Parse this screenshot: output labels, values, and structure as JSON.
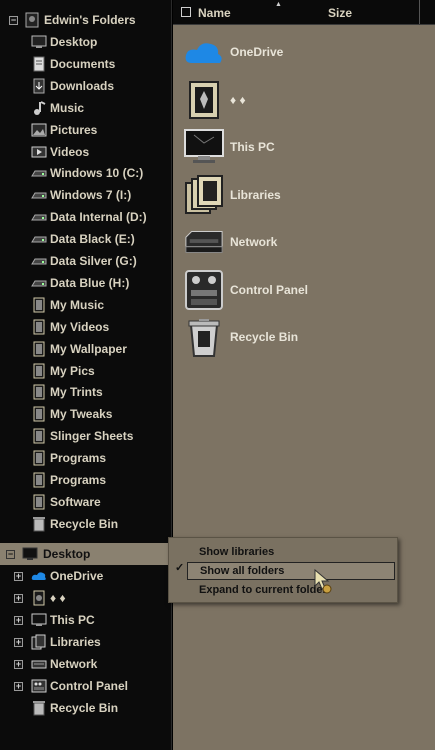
{
  "nav": {
    "root": {
      "label": "Edwin's Folders",
      "icon": "user-folder-icon"
    },
    "items": [
      {
        "label": "Desktop",
        "icon": "desktop-icon"
      },
      {
        "label": "Documents",
        "icon": "documents-icon"
      },
      {
        "label": "Downloads",
        "icon": "downloads-icon"
      },
      {
        "label": "Music",
        "icon": "music-icon"
      },
      {
        "label": "Pictures",
        "icon": "pictures-icon"
      },
      {
        "label": "Videos",
        "icon": "videos-icon"
      },
      {
        "label": "Windows 10 (C:)",
        "icon": "drive-icon"
      },
      {
        "label": "Windows 7 (I:)",
        "icon": "drive-icon"
      },
      {
        "label": "Data Internal (D:)",
        "icon": "drive-icon"
      },
      {
        "label": "Data Black (E:)",
        "icon": "drive-icon"
      },
      {
        "label": "Data Silver (G:)",
        "icon": "drive-icon"
      },
      {
        "label": "Data Blue (H:)",
        "icon": "drive-icon"
      },
      {
        "label": "My Music",
        "icon": "folder-icon"
      },
      {
        "label": "My Videos",
        "icon": "folder-icon"
      },
      {
        "label": "My Wallpaper",
        "icon": "folder-icon"
      },
      {
        "label": "My Pics",
        "icon": "folder-icon"
      },
      {
        "label": "My Trints",
        "icon": "folder-icon"
      },
      {
        "label": "My Tweaks",
        "icon": "folder-icon"
      },
      {
        "label": "Slinger Sheets",
        "icon": "folder-icon"
      },
      {
        "label": "Programs",
        "icon": "folder-icon"
      },
      {
        "label": "Programs",
        "icon": "folder-icon"
      },
      {
        "label": "Software",
        "icon": "folder-icon"
      },
      {
        "label": "Recycle Bin",
        "icon": "recycle-bin-icon"
      }
    ],
    "desktop": {
      "label": "Desktop",
      "icon": "desktop-icon"
    },
    "desktop_children": [
      {
        "label": "OneDrive",
        "icon": "onedrive-icon"
      },
      {
        "label": "♦ ♦",
        "icon": "user-folder-icon"
      },
      {
        "label": "This PC",
        "icon": "this-pc-icon"
      },
      {
        "label": "Libraries",
        "icon": "libraries-icon"
      },
      {
        "label": "Network",
        "icon": "network-icon"
      },
      {
        "label": "Control Panel",
        "icon": "control-panel-icon"
      },
      {
        "label": "Recycle Bin",
        "icon": "recycle-bin-icon"
      }
    ],
    "expand_symbol": "⊞",
    "collapse_symbol": "⊟"
  },
  "content": {
    "columns": {
      "name": "Name",
      "size": "Size"
    },
    "items": [
      {
        "label": "OneDrive",
        "icon": "onedrive-icon"
      },
      {
        "label": "♦ ♦",
        "icon": "user-folder-icon"
      },
      {
        "label": "This PC",
        "icon": "this-pc-icon"
      },
      {
        "label": "Libraries",
        "icon": "libraries-icon"
      },
      {
        "label": "Network",
        "icon": "network-icon"
      },
      {
        "label": "Control Panel",
        "icon": "control-panel-icon"
      },
      {
        "label": "Recycle Bin",
        "icon": "recycle-bin-icon"
      }
    ]
  },
  "context_menu": {
    "items": [
      {
        "label": "Show libraries",
        "checked": false
      },
      {
        "label": "Show all folders",
        "checked": true
      },
      {
        "label": "Expand to current folder",
        "checked": false
      }
    ],
    "check_glyph": "✓"
  },
  "colors": {
    "nav_bg": "#0b0b0b",
    "content_bg": "#7d7363",
    "text_light": "#d8d2c0",
    "selection": "#8a8170",
    "onedrive_blue": "#1e88e5"
  }
}
